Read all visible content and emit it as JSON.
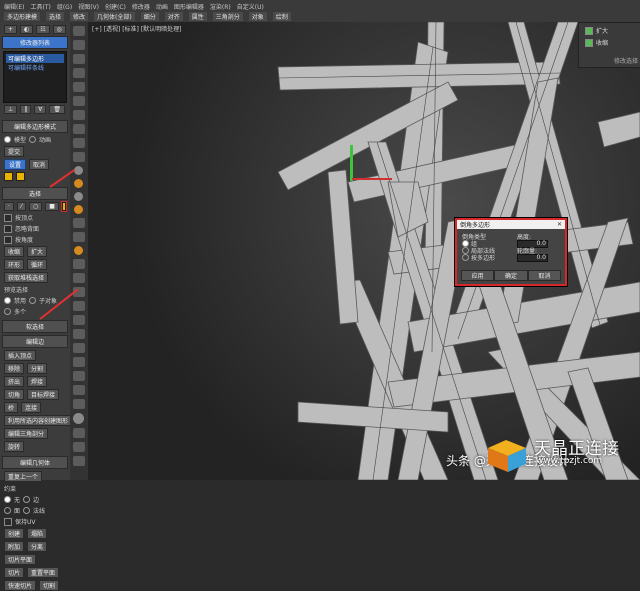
{
  "menu": {
    "row1": [
      "编辑(E)",
      "工具(T)",
      "组(G)",
      "视图(V)",
      "创建(C)",
      "修改器",
      "动画",
      "图形编辑器",
      "渲染(R)",
      "自定义(U)"
    ],
    "row2": [
      "多边形建模",
      "选择",
      "修改",
      "几何体(全部)",
      "细分",
      "对齐",
      "属性",
      "三角剖分",
      "对象",
      "绘制"
    ]
  },
  "viewport": {
    "label": "[+] [透视] [标准] [默认明暗处理]"
  },
  "command_panel": {
    "object_list_title": "修改器列表",
    "object_list_items": [
      "可编辑多边形",
      "可编辑样条线"
    ],
    "edit_poly_mode": "编辑多边形模式",
    "model_label": "模型",
    "animate_label": "动画",
    "commit_label": "提交",
    "settings_label": "设置",
    "cancel_label": "取消",
    "selection_head": "选择",
    "by_vertex": "按顶点",
    "ignore_backfacing": "忽略背面",
    "by_angle": "按角度",
    "shrink": "收缩",
    "grow": "扩大",
    "ring": "环形",
    "loop": "循环",
    "get_stack_selection": "获取堆栈选择",
    "preview_selection": "预览选择",
    "off": "禁用",
    "subobject": "子对象",
    "multi": "多个",
    "soft_selection": "软选择",
    "edit_edges": "编辑边",
    "insert_vertex": "插入顶点",
    "remove": "移除",
    "split": "分割",
    "extrude": "挤出",
    "weld": "焊接",
    "chamfer": "切角",
    "target_weld": "目标焊接",
    "bridge": "桥",
    "connect": "连接",
    "create_shape": "利用所选内容创建图形",
    "edit_tri": "编辑三角剖分",
    "turn": "旋转",
    "repeat_last": "重复上一个",
    "edit_geometry": "编辑几何体",
    "constraints": "约束",
    "none": "无",
    "edge": "边",
    "face": "面",
    "normal": "法线",
    "preserve_uvs": "保持UV",
    "create": "创建",
    "collapse": "塌陷",
    "attach": "附加",
    "detach": "分离",
    "slice_plane": "切片平面",
    "slice": "切片",
    "reset_plane": "重置平面",
    "quickslice": "快速切片",
    "cut": "切割"
  },
  "right_panel": {
    "expand_label": "扩大",
    "shrink_label": "收缩",
    "footer": "修改选择"
  },
  "dialog": {
    "title": "倒角多边形",
    "type_label": "倒角类型",
    "group": "组",
    "local_normal": "局部法线",
    "by_polygon": "按多边形",
    "height_label": "高度:",
    "height_value": "0.0",
    "outline_label": "轮廓量:",
    "outline_value": "0.0",
    "ok": "确定",
    "apply": "应用",
    "cancel": "取消"
  },
  "watermark": {
    "credit": "头条 @天晶正连接设计",
    "brand": "天晶正连接",
    "url": "www.tpzjt.com"
  },
  "colors": {
    "highlight_red": "#d62828",
    "accent_blue": "#3b74c8",
    "accent_yellow": "#e8b400",
    "gizmo_green": "#3dc43d",
    "gizmo_red": "#d03030"
  }
}
